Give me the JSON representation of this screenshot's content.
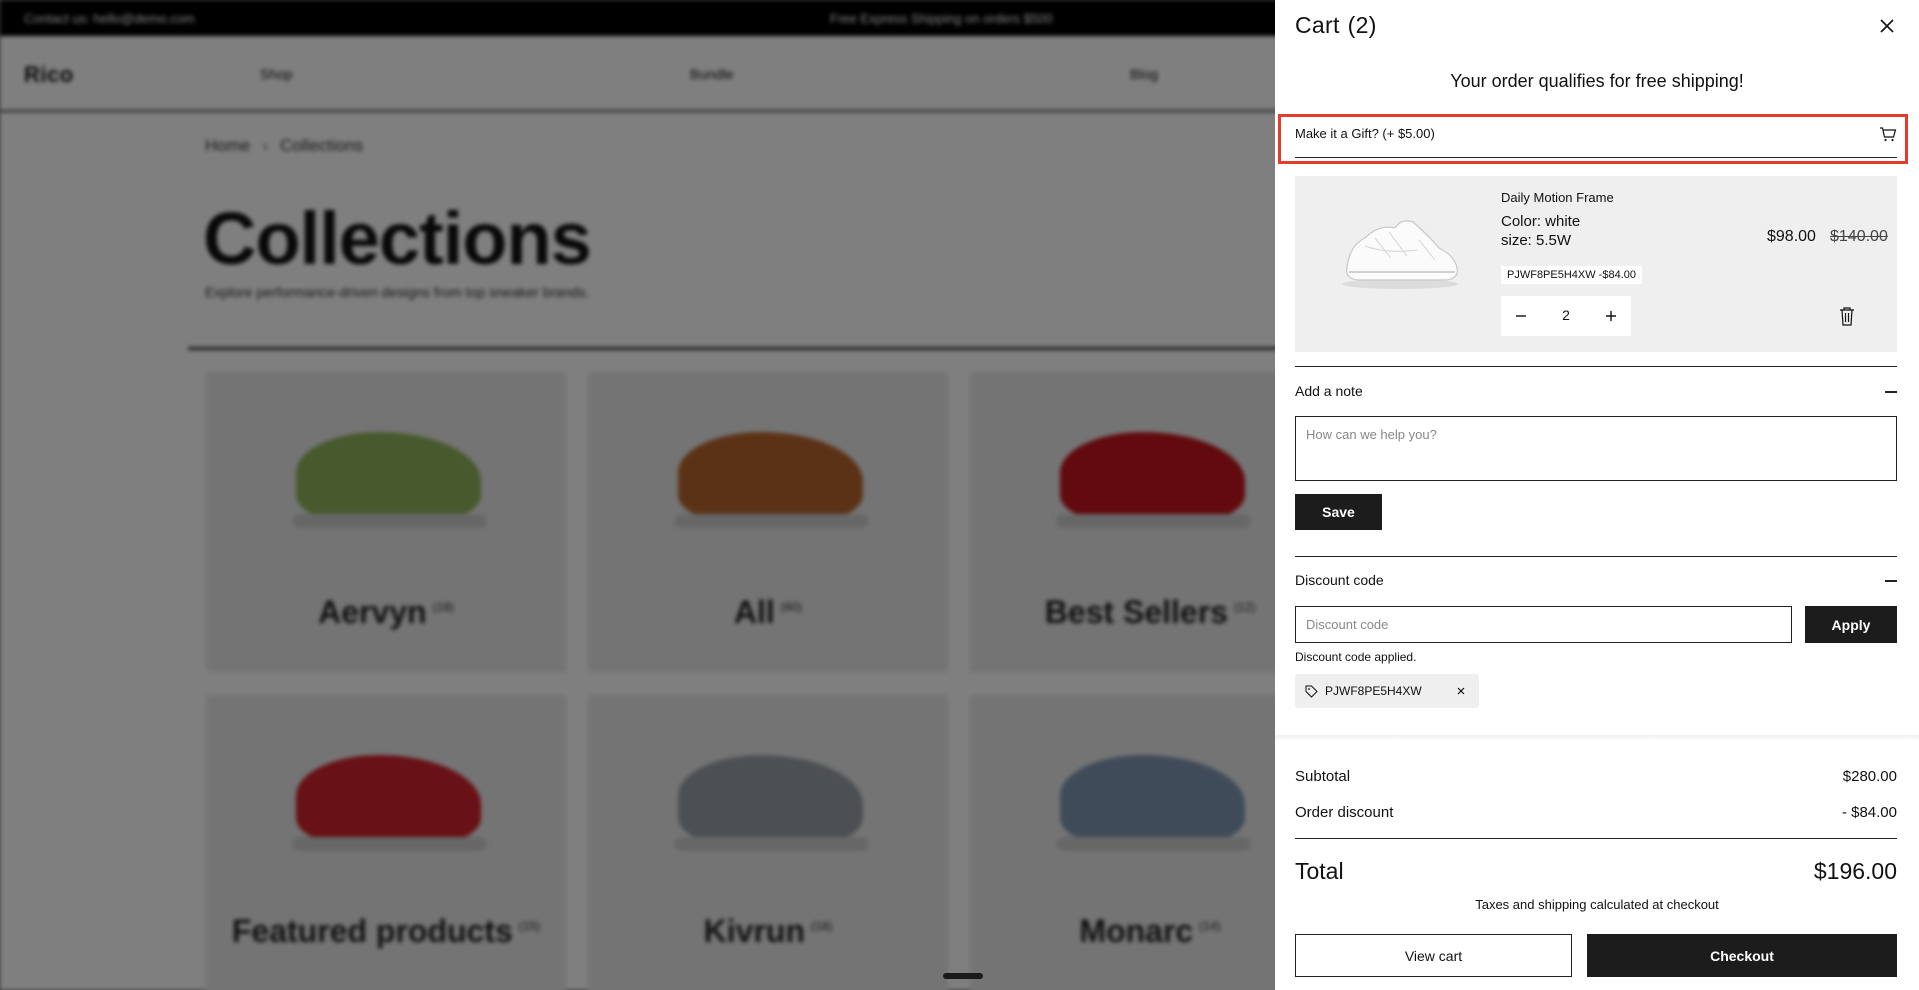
{
  "background": {
    "topbar": {
      "contact": "Contact us: hello@demo.com",
      "shipping": "Free Express Shipping on orders $500"
    },
    "brand": "Rico",
    "nav": [
      "Shop",
      "Bundle",
      "Blog"
    ],
    "breadcrumb": [
      "Home",
      "Collections"
    ],
    "title": "Collections",
    "subtitle": "Explore performance-driven designs from top sneaker brands.",
    "collections": [
      {
        "name": "Aervyn",
        "count": "(18)",
        "color": "#8fb25a"
      },
      {
        "name": "All",
        "count": "(60)",
        "color": "#b8652e"
      },
      {
        "name": "Best Sellers",
        "count": "(12)",
        "color": "#c4151c"
      },
      {
        "name": "Featured products",
        "count": "(15)",
        "color": "#d0232c"
      },
      {
        "name": "Kivrun",
        "count": "(18)",
        "color": "#9aa0a6"
      },
      {
        "name": "Monarc",
        "count": "(14)",
        "color": "#7f97b2"
      }
    ]
  },
  "cart": {
    "title": "Cart",
    "count": "(2)",
    "free_shipping": "Your order qualifies for free shipping!",
    "gift_label": "Make it a Gift? (+ $5.00)",
    "item": {
      "name": "Daily Motion Frame",
      "color": "Color:  white",
      "size": "size:  5.5W",
      "code_tag": "PJWF8PE5H4XW -$84.00",
      "price": "$98.00",
      "old_price": "$140.00",
      "quantity": "2"
    },
    "note": {
      "label": "Add a note",
      "placeholder": "How can we help you?",
      "save": "Save"
    },
    "discount": {
      "label": "Discount code",
      "placeholder": "Discount code",
      "apply": "Apply",
      "applied_msg": "Discount code applied.",
      "code": "PJWF8PE5H4XW"
    },
    "summary": {
      "subtotal_label": "Subtotal",
      "subtotal": "$280.00",
      "discount_label": "Order discount",
      "discount": "- $84.00",
      "total_label": "Total",
      "total": "$196.00",
      "tax_note": "Taxes and shipping calculated at checkout"
    },
    "buttons": {
      "view_cart": "View cart",
      "checkout": "Checkout"
    }
  },
  "colors": {
    "highlight": "#e53b2c",
    "dark": "#1c1c1c"
  }
}
